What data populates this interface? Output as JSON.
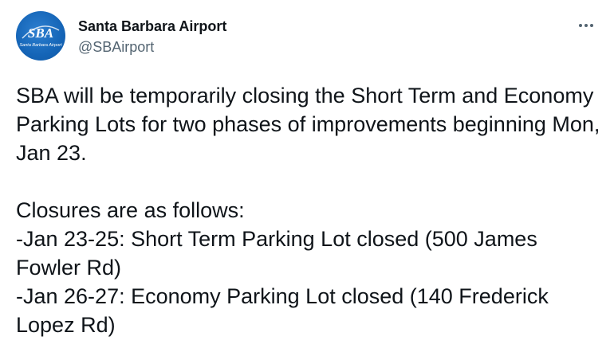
{
  "account": {
    "display_name": "Santa Barbara Airport",
    "handle": "@SBAirport",
    "avatar_logo": "SBA",
    "avatar_subtext": "Santa Barbara Airport",
    "avatar_bg": "#1565b7"
  },
  "menu": {
    "more_icon": "more-horizontal-icon"
  },
  "tweet": {
    "para1": "SBA will be temporarily closing the Short Term and Economy Parking Lots for two phases of improvements beginning Mon, Jan 23.",
    "para2_heading": "Closures are as follows:",
    "line1": "-Jan 23-25: Short Term Parking Lot closed (500 James Fowler Rd)",
    "line2": "-Jan 26-27: Economy Parking Lot closed (140 Frederick Lopez Rd)"
  }
}
